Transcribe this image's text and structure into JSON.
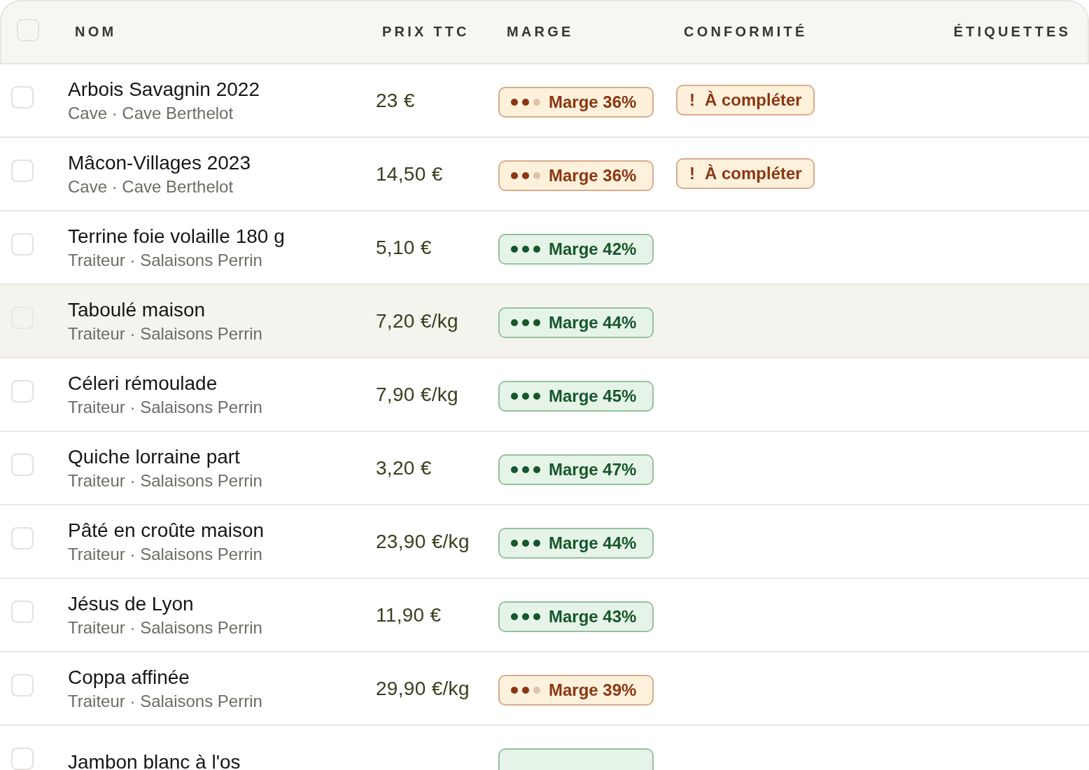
{
  "table": {
    "select_all": {
      "checked": false
    },
    "columns": [
      {
        "label": "NOM"
      },
      {
        "label": "PRIX TTC"
      },
      {
        "label": "MARGE"
      },
      {
        "label": "CONFORMITÉ"
      },
      {
        "label": "ÉTIQUETTES"
      }
    ],
    "rows": [
      {
        "name": "Arbois Savagnin 2022",
        "subtitle": "Cave · Cave Berthelot",
        "price": "23 €",
        "checked": false,
        "highlighted": false,
        "margin": {
          "label": "Marge 36%",
          "kind": "warning",
          "stars": 2
        },
        "compliance": {
          "mark": "!",
          "label": "À compléter"
        }
      },
      {
        "name": "Mâcon-Villages 2023",
        "subtitle": "Cave · Cave Berthelot",
        "price": "14,50 €",
        "checked": false,
        "highlighted": false,
        "margin": {
          "label": "Marge 36%",
          "kind": "warning",
          "stars": 2
        },
        "compliance": {
          "mark": "!",
          "label": "À compléter"
        }
      },
      {
        "name": "Terrine foie volaille 180 g",
        "subtitle": "Traiteur · Salaisons Perrin",
        "price": "5,10 €",
        "checked": false,
        "highlighted": false,
        "margin": {
          "label": "Marge 42%",
          "kind": "good",
          "stars": 3
        }
      },
      {
        "name": "Taboulé maison",
        "subtitle": "Traiteur · Salaisons Perrin",
        "price": "7,20 €/kg",
        "checked": false,
        "highlighted": true,
        "margin": {
          "label": "Marge 44%",
          "kind": "good",
          "stars": 3
        }
      },
      {
        "name": "Céleri rémoulade",
        "subtitle": "Traiteur · Salaisons Perrin",
        "price": "7,90 €/kg",
        "checked": false,
        "highlighted": false,
        "margin": {
          "label": "Marge 45%",
          "kind": "good",
          "stars": 3
        }
      },
      {
        "name": "Quiche lorraine part",
        "subtitle": "Traiteur · Salaisons Perrin",
        "price": "3,20 €",
        "checked": false,
        "highlighted": false,
        "margin": {
          "label": "Marge 47%",
          "kind": "good",
          "stars": 3
        }
      },
      {
        "name": "Pâté en croûte maison",
        "subtitle": "Traiteur · Salaisons Perrin",
        "price": "23,90 €/kg",
        "checked": false,
        "highlighted": false,
        "margin": {
          "label": "Marge 44%",
          "kind": "good",
          "stars": 3
        }
      },
      {
        "name": "Jésus de Lyon",
        "subtitle": "Traiteur · Salaisons Perrin",
        "price": "11,90 €",
        "checked": false,
        "highlighted": false,
        "margin": {
          "label": "Marge 43%",
          "kind": "good",
          "stars": 3
        }
      },
      {
        "name": "Coppa affinée",
        "subtitle": "Traiteur · Salaisons Perrin",
        "price": "29,90 €/kg",
        "checked": false,
        "highlighted": false,
        "margin": {
          "label": "Marge 39%",
          "kind": "warning",
          "stars": 2
        }
      },
      {
        "name": "Jambon blanc à l'os",
        "checked": false,
        "highlighted": false,
        "margin": {
          "kind": "good"
        }
      }
    ]
  }
}
